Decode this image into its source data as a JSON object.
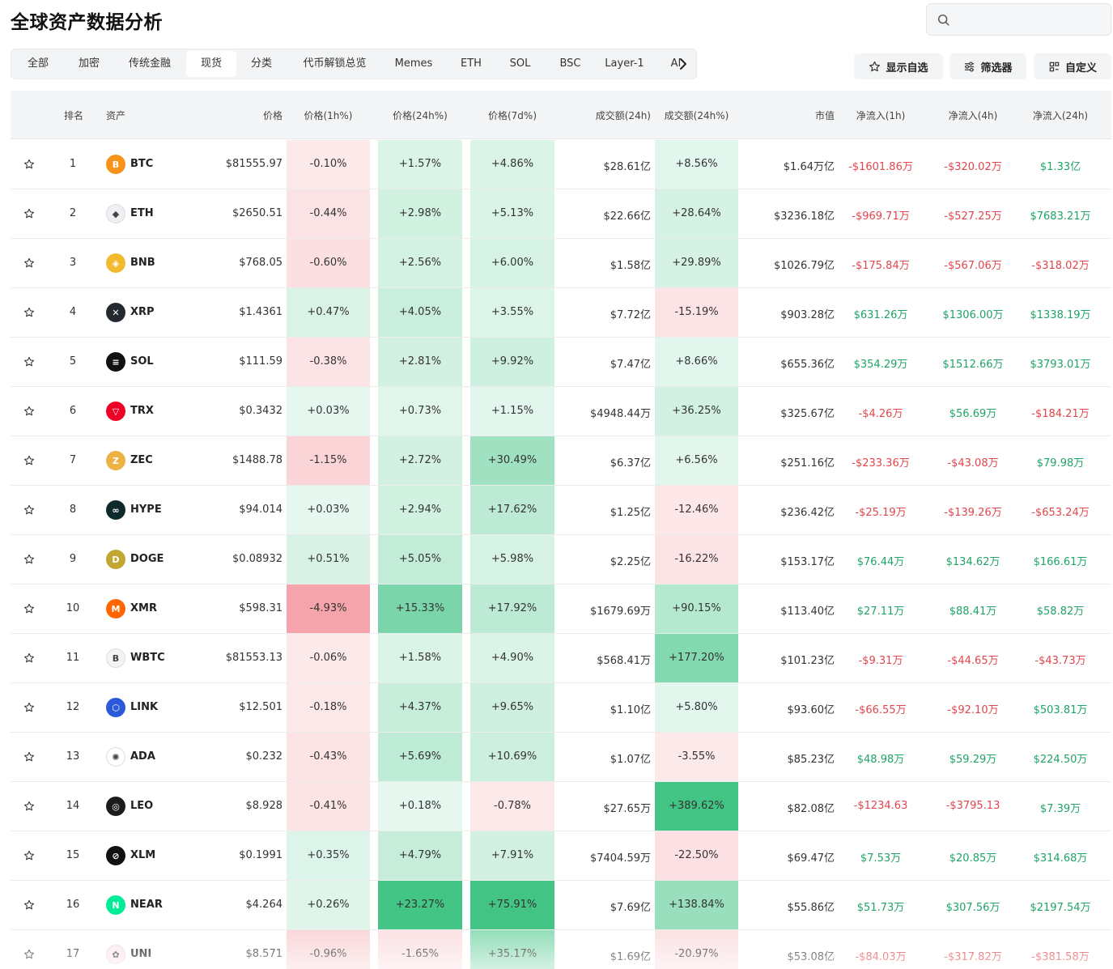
{
  "page": {
    "title": "全球资产数据分析"
  },
  "search": {
    "placeholder": ""
  },
  "tabs": [
    "全部",
    "加密",
    "传统金融",
    "现货",
    "分类",
    "代币解锁总览",
    "Memes",
    "ETH",
    "SOL",
    "BSC",
    "Layer-1",
    "AI"
  ],
  "active_tab": "现货",
  "buttons": {
    "watchlist": "显示自选",
    "filter": "筛选器",
    "customize": "自定义"
  },
  "columns": {
    "rank": "排名",
    "asset": "资产",
    "price": "价格",
    "p1h": "价格(1h%)",
    "p24h": "价格(24h%)",
    "p7d": "价格(7d%)",
    "vol": "成交额(24h)",
    "vol24": "成交额(24h%)",
    "mcap": "市值",
    "in1h": "净流入(1h)",
    "in4h": "净流入(4h)",
    "in24h": "净流入(24h)"
  },
  "colors": {
    "positive": "#1fa366",
    "negative": "#e2454b"
  },
  "rows": [
    {
      "rank": "1",
      "symbol": "BTC",
      "icon": "bitcoin-icon",
      "color": "#f7931a",
      "glyph": "B",
      "price": "$81555.97",
      "p1h": "-0.10%",
      "p24h": "+1.57%",
      "p7d": "+4.86%",
      "vol": "$28.61亿",
      "vol24": "+8.56%",
      "mcap": "$1.64万亿",
      "in1h": "-$1601.86万",
      "in4h": "-$320.02万",
      "in24h": "$1.33亿"
    },
    {
      "rank": "2",
      "symbol": "ETH",
      "icon": "ethereum-icon",
      "color": "#eef0f3",
      "glyph": "◆",
      "price": "$2650.51",
      "p1h": "-0.44%",
      "p24h": "+2.98%",
      "p7d": "+5.13%",
      "vol": "$22.66亿",
      "vol24": "+28.64%",
      "mcap": "$3236.18亿",
      "in1h": "-$969.71万",
      "in4h": "-$527.25万",
      "in24h": "$7683.21万"
    },
    {
      "rank": "3",
      "symbol": "BNB",
      "icon": "bnb-icon",
      "color": "#f3ba2f",
      "glyph": "◈",
      "price": "$768.05",
      "p1h": "-0.60%",
      "p24h": "+2.56%",
      "p7d": "+6.00%",
      "vol": "$1.58亿",
      "vol24": "+29.89%",
      "mcap": "$1026.79亿",
      "in1h": "-$175.84万",
      "in4h": "-$567.06万",
      "in24h": "-$318.02万"
    },
    {
      "rank": "4",
      "symbol": "XRP",
      "icon": "xrp-icon",
      "color": "#23292f",
      "glyph": "✕",
      "price": "$1.4361",
      "p1h": "+0.47%",
      "p24h": "+4.05%",
      "p7d": "+3.55%",
      "vol": "$7.72亿",
      "vol24": "-15.19%",
      "mcap": "$903.28亿",
      "in1h": "$631.26万",
      "in4h": "$1306.00万",
      "in24h": "$1338.19万"
    },
    {
      "rank": "5",
      "symbol": "SOL",
      "icon": "solana-icon",
      "color": "#111111",
      "glyph": "≡",
      "price": "$111.59",
      "p1h": "-0.38%",
      "p24h": "+2.81%",
      "p7d": "+9.92%",
      "vol": "$7.47亿",
      "vol24": "+8.66%",
      "mcap": "$655.36亿",
      "in1h": "$354.29万",
      "in4h": "$1512.66万",
      "in24h": "$3793.01万"
    },
    {
      "rank": "6",
      "symbol": "TRX",
      "icon": "tron-icon",
      "color": "#ef0027",
      "glyph": "▽",
      "price": "$0.3432",
      "p1h": "+0.03%",
      "p24h": "+0.73%",
      "p7d": "+1.15%",
      "vol": "$4948.44万",
      "vol24": "+36.25%",
      "mcap": "$325.67亿",
      "in1h": "-$4.26万",
      "in4h": "$56.69万",
      "in24h": "-$184.21万"
    },
    {
      "rank": "7",
      "symbol": "ZEC",
      "icon": "zcash-icon",
      "color": "#ecb244",
      "glyph": "Z",
      "price": "$1488.78",
      "p1h": "-1.15%",
      "p24h": "+2.72%",
      "p7d": "+30.49%",
      "vol": "$6.37亿",
      "vol24": "+6.56%",
      "mcap": "$251.16亿",
      "in1h": "-$233.36万",
      "in4h": "-$43.08万",
      "in24h": "$79.98万"
    },
    {
      "rank": "8",
      "symbol": "HYPE",
      "icon": "hyperliquid-icon",
      "color": "#0f2a2a",
      "glyph": "∞",
      "price": "$94.014",
      "p1h": "+0.03%",
      "p24h": "+2.94%",
      "p7d": "+17.62%",
      "vol": "$1.25亿",
      "vol24": "-12.46%",
      "mcap": "$236.42亿",
      "in1h": "-$25.19万",
      "in4h": "-$139.26万",
      "in24h": "-$653.24万"
    },
    {
      "rank": "9",
      "symbol": "DOGE",
      "icon": "dogecoin-icon",
      "color": "#c2a633",
      "glyph": "D",
      "price": "$0.08932",
      "p1h": "+0.51%",
      "p24h": "+5.05%",
      "p7d": "+5.98%",
      "vol": "$2.25亿",
      "vol24": "-16.22%",
      "mcap": "$153.17亿",
      "in1h": "$76.44万",
      "in4h": "$134.62万",
      "in24h": "$166.61万"
    },
    {
      "rank": "10",
      "symbol": "XMR",
      "icon": "monero-icon",
      "color": "#ff6600",
      "glyph": "M",
      "price": "$598.31",
      "p1h": "-4.93%",
      "p24h": "+15.33%",
      "p7d": "+17.92%",
      "vol": "$1679.69万",
      "vol24": "+90.15%",
      "mcap": "$113.40亿",
      "in1h": "$27.11万",
      "in4h": "$88.41万",
      "in24h": "$58.82万"
    },
    {
      "rank": "11",
      "symbol": "WBTC",
      "icon": "wbtc-icon",
      "color": "#f4f4f6",
      "glyph": "B",
      "price": "$81553.13",
      "p1h": "-0.06%",
      "p24h": "+1.58%",
      "p7d": "+4.90%",
      "vol": "$568.41万",
      "vol24": "+177.20%",
      "mcap": "$101.23亿",
      "in1h": "-$9.31万",
      "in4h": "-$44.65万",
      "in24h": "-$43.73万"
    },
    {
      "rank": "12",
      "symbol": "LINK",
      "icon": "chainlink-icon",
      "color": "#2a5ada",
      "glyph": "⬡",
      "price": "$12.501",
      "p1h": "-0.18%",
      "p24h": "+4.37%",
      "p7d": "+9.65%",
      "vol": "$1.10亿",
      "vol24": "+5.80%",
      "mcap": "$93.60亿",
      "in1h": "-$66.55万",
      "in4h": "-$92.10万",
      "in24h": "$503.81万"
    },
    {
      "rank": "13",
      "symbol": "ADA",
      "icon": "cardano-icon",
      "color": "#ffffff",
      "glyph": "✺",
      "price": "$0.232",
      "p1h": "-0.43%",
      "p24h": "+5.69%",
      "p7d": "+10.69%",
      "vol": "$1.07亿",
      "vol24": "-3.55%",
      "mcap": "$85.23亿",
      "in1h": "$48.98万",
      "in4h": "$59.29万",
      "in24h": "$224.50万"
    },
    {
      "rank": "14",
      "symbol": "LEO",
      "icon": "leo-icon",
      "color": "#1c1c1c",
      "glyph": "◎",
      "price": "$8.928",
      "p1h": "-0.41%",
      "p24h": "+0.18%",
      "p7d": "-0.78%",
      "vol": "$27.65万",
      "vol24": "+389.62%",
      "mcap": "$82.08亿",
      "in1h": "-$1234.63",
      "in4h": "-$3795.13",
      "in24h": "$7.39万"
    },
    {
      "rank": "15",
      "symbol": "XLM",
      "icon": "stellar-icon",
      "color": "#111111",
      "glyph": "⊘",
      "price": "$0.1991",
      "p1h": "+0.35%",
      "p24h": "+4.79%",
      "p7d": "+7.91%",
      "vol": "$7404.59万",
      "vol24": "-22.50%",
      "mcap": "$69.47亿",
      "in1h": "$7.53万",
      "in4h": "$20.85万",
      "in24h": "$314.68万"
    },
    {
      "rank": "16",
      "symbol": "NEAR",
      "icon": "near-icon",
      "color": "#00ec97",
      "glyph": "N",
      "price": "$4.264",
      "p1h": "+0.26%",
      "p24h": "+23.27%",
      "p7d": "+75.91%",
      "vol": "$7.69亿",
      "vol24": "+138.84%",
      "mcap": "$55.86亿",
      "in1h": "$51.73万",
      "in4h": "$307.56万",
      "in24h": "$2197.54万"
    },
    {
      "rank": "17",
      "symbol": "UNI",
      "icon": "uniswap-icon",
      "color": "#fde8f3",
      "glyph": "✿",
      "price": "$8.571",
      "p1h": "-0.96%",
      "p24h": "-1.65%",
      "p7d": "+35.17%",
      "vol": "$1.69亿",
      "vol24": "-20.97%",
      "mcap": "$53.08亿",
      "in1h": "-$84.03万",
      "in4h": "-$317.82万",
      "in24h": "-$381.58万"
    }
  ]
}
